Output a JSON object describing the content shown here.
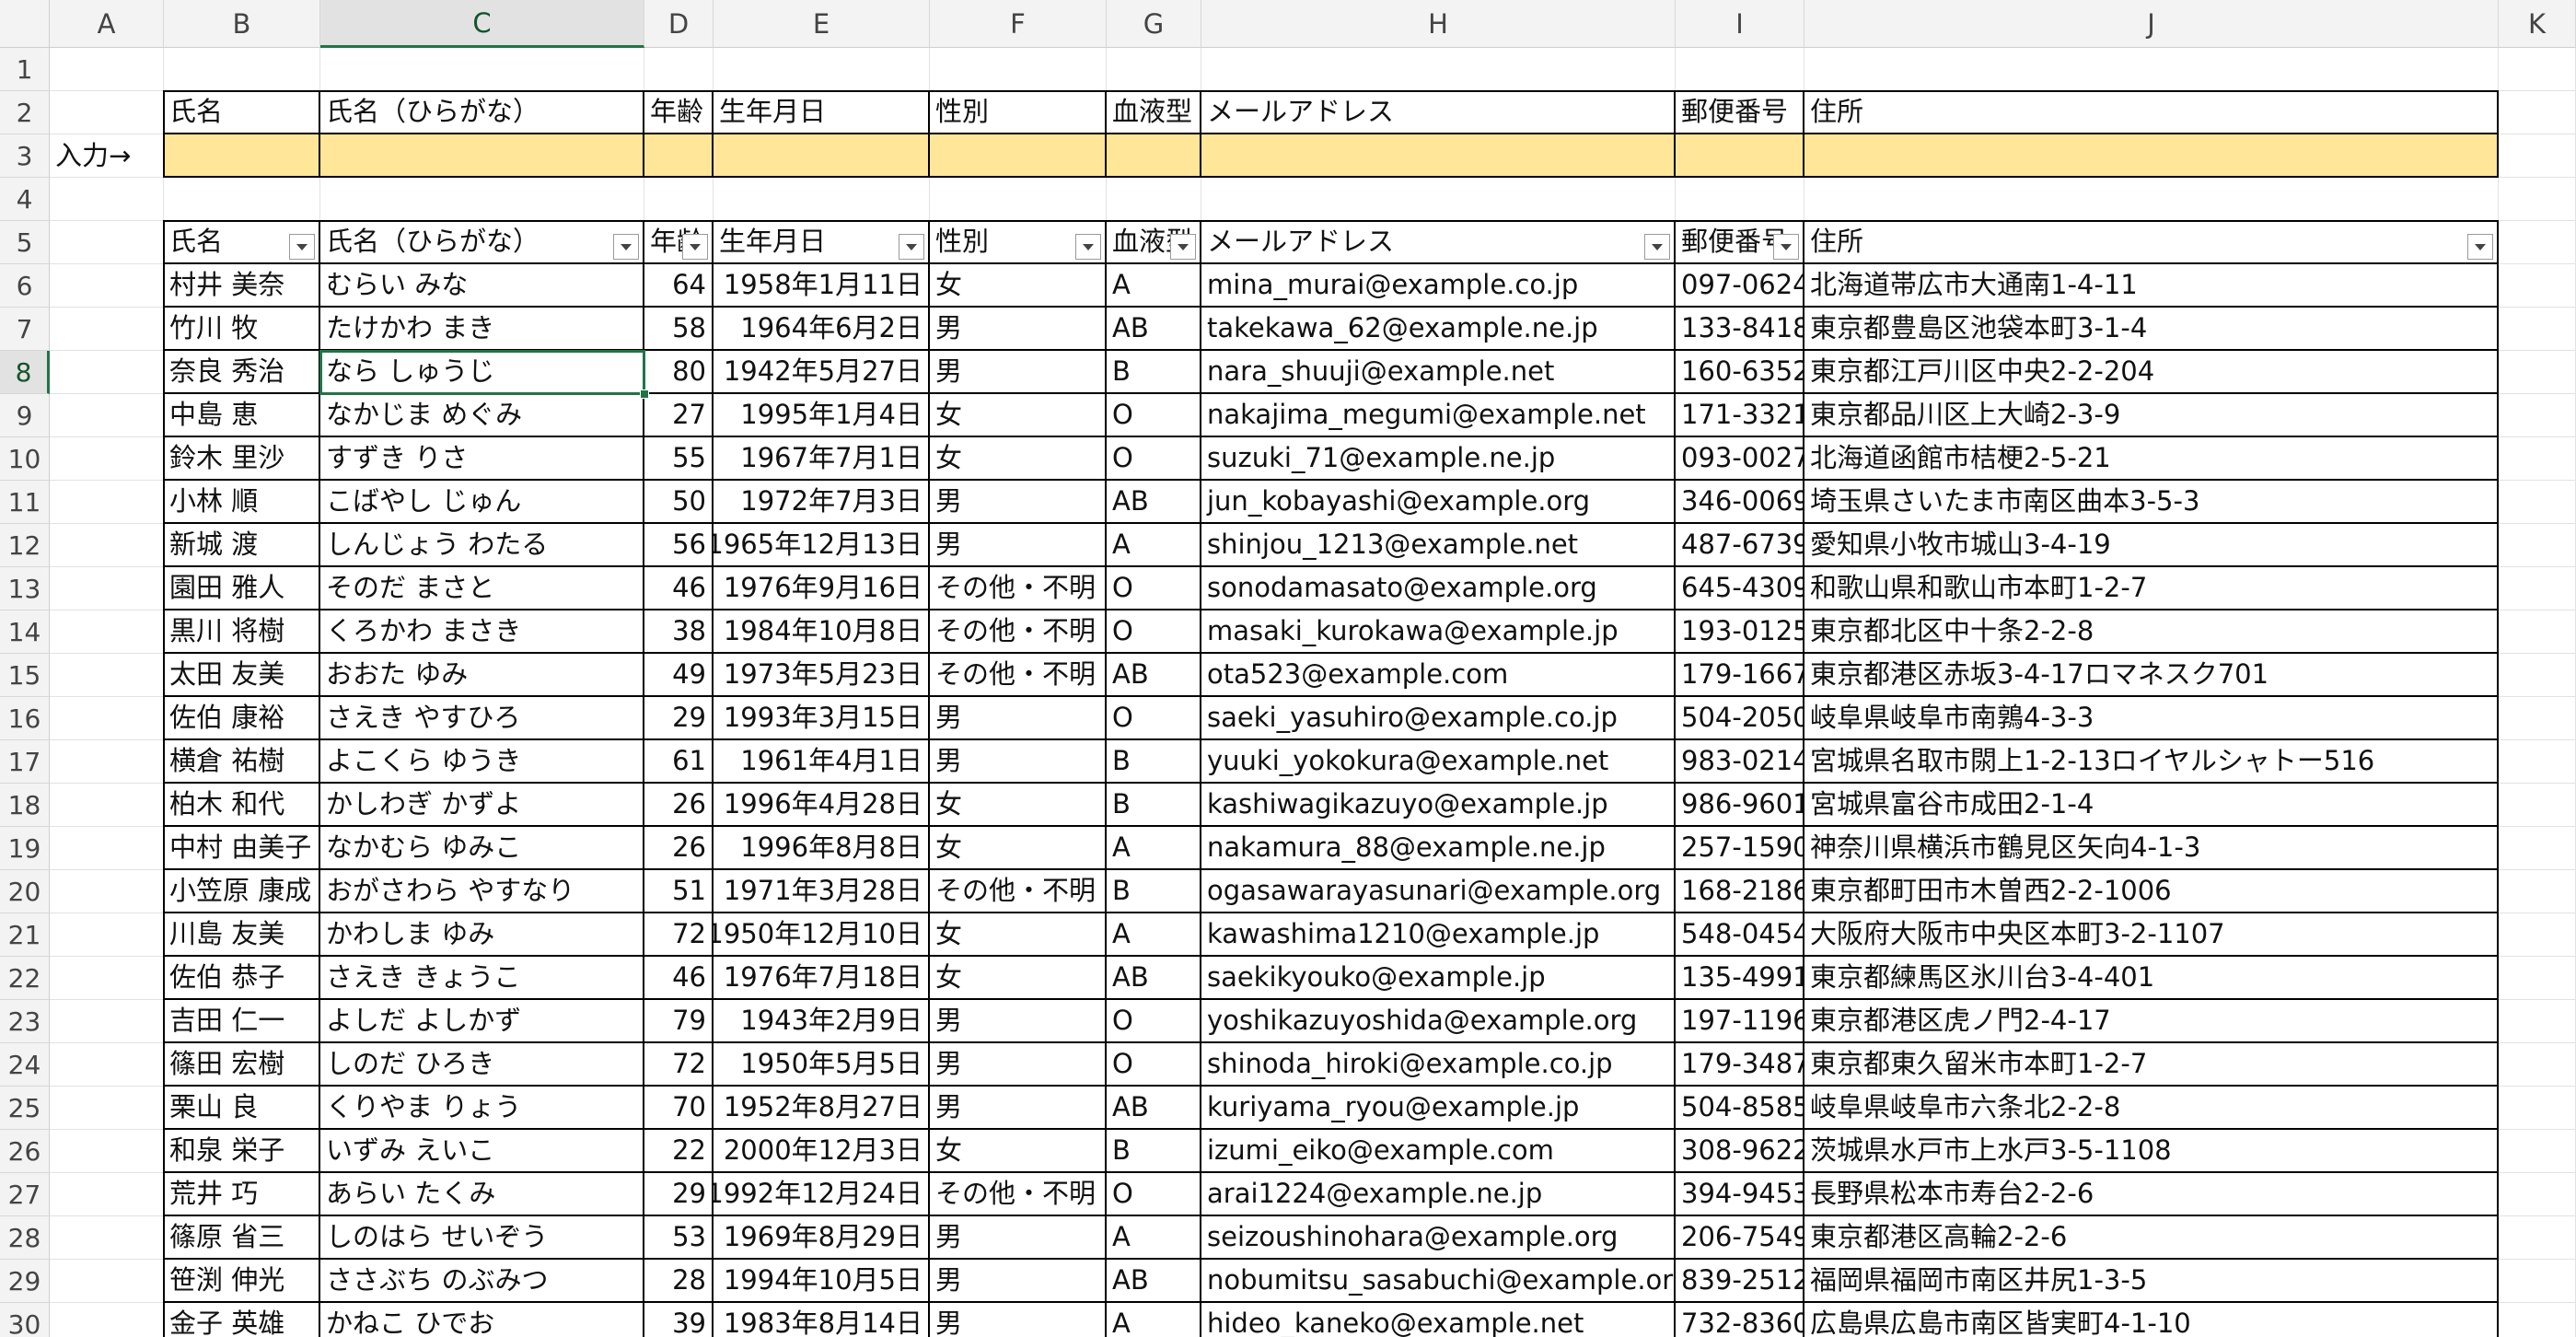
{
  "columns": [
    "A",
    "B",
    "C",
    "D",
    "E",
    "F",
    "G",
    "H",
    "I",
    "J",
    "K"
  ],
  "selected_column": "C",
  "selected_row": 8,
  "row_numbers": [
    1,
    2,
    3,
    4,
    5,
    6,
    7,
    8,
    9,
    10,
    11,
    12,
    13,
    14,
    15,
    16,
    17,
    18,
    19,
    20,
    21,
    22,
    23,
    24,
    25,
    26,
    27,
    28,
    29,
    30
  ],
  "input_label": "入力→",
  "input_headers": [
    "氏名",
    "氏名（ひらがな）",
    "年齢",
    "生年月日",
    "性別",
    "血液型",
    "メールアドレス",
    "郵便番号",
    "住所"
  ],
  "table_headers": [
    "氏名",
    "氏名（ひらがな）",
    "年齢",
    "生年月日",
    "性別",
    "血液型",
    "メールアドレス",
    "郵便番号",
    "住所"
  ],
  "colors": {
    "highlight": "#ffe699",
    "accent": "#217346"
  },
  "rows": [
    [
      "村井 美奈",
      "むらい みな",
      "64",
      "1958年1月11日",
      "女",
      "A",
      "mina_murai@example.co.jp",
      "097-0624",
      "北海道帯広市大通南1-4-11"
    ],
    [
      "竹川 牧",
      "たけかわ まき",
      "58",
      "1964年6月2日",
      "男",
      "AB",
      "takekawa_62@example.ne.jp",
      "133-8418",
      "東京都豊島区池袋本町3-1-4"
    ],
    [
      "奈良 秀治",
      "なら しゅうじ",
      "80",
      "1942年5月27日",
      "男",
      "B",
      "nara_shuuji@example.net",
      "160-6352",
      "東京都江戸川区中央2-2-204"
    ],
    [
      "中島 恵",
      "なかじま めぐみ",
      "27",
      "1995年1月4日",
      "女",
      "O",
      "nakajima_megumi@example.net",
      "171-3321",
      "東京都品川区上大崎2-3-9"
    ],
    [
      "鈴木 里沙",
      "すずき りさ",
      "55",
      "1967年7月1日",
      "女",
      "O",
      "suzuki_71@example.ne.jp",
      "093-0027",
      "北海道函館市桔梗2-5-21"
    ],
    [
      "小林 順",
      "こばやし じゅん",
      "50",
      "1972年7月3日",
      "男",
      "AB",
      "jun_kobayashi@example.org",
      "346-0069",
      "埼玉県さいたま市南区曲本3-5-3"
    ],
    [
      "新城 渡",
      "しんじょう わたる",
      "56",
      "1965年12月13日",
      "男",
      "A",
      "shinjou_1213@example.net",
      "487-6739",
      "愛知県小牧市城山3-4-19"
    ],
    [
      "園田 雅人",
      "そのだ まさと",
      "46",
      "1976年9月16日",
      "その他・不明",
      "O",
      "sonodamasato@example.org",
      "645-4309",
      "和歌山県和歌山市本町1-2-7"
    ],
    [
      "黒川 将樹",
      "くろかわ まさき",
      "38",
      "1984年10月8日",
      "その他・不明",
      "O",
      "masaki_kurokawa@example.jp",
      "193-0125",
      "東京都北区中十条2-2-8"
    ],
    [
      "太田 友美",
      "おおた ゆみ",
      "49",
      "1973年5月23日",
      "その他・不明",
      "AB",
      "ota523@example.com",
      "179-1667",
      "東京都港区赤坂3-4-17ロマネスク701"
    ],
    [
      "佐伯 康裕",
      "さえき やすひろ",
      "29",
      "1993年3月15日",
      "男",
      "O",
      "saeki_yasuhiro@example.co.jp",
      "504-2050",
      "岐阜県岐阜市南鶉4-3-3"
    ],
    [
      "横倉 祐樹",
      "よこくら ゆうき",
      "61",
      "1961年4月1日",
      "男",
      "B",
      "yuuki_yokokura@example.net",
      "983-0214",
      "宮城県名取市閖上1-2-13ロイヤルシャトー516"
    ],
    [
      "柏木 和代",
      "かしわぎ かずよ",
      "26",
      "1996年4月28日",
      "女",
      "B",
      "kashiwagikazuyo@example.jp",
      "986-9601",
      "宮城県富谷市成田2-1-4"
    ],
    [
      "中村 由美子",
      "なかむら ゆみこ",
      "26",
      "1996年8月8日",
      "女",
      "A",
      "nakamura_88@example.ne.jp",
      "257-1590",
      "神奈川県横浜市鶴見区矢向4-1-3"
    ],
    [
      "小笠原 康成",
      "おがさわら やすなり",
      "51",
      "1971年3月28日",
      "その他・不明",
      "B",
      "ogasawarayasunari@example.org",
      "168-2186",
      "東京都町田市木曽西2-2-1006"
    ],
    [
      "川島 友美",
      "かわしま ゆみ",
      "72",
      "1950年12月10日",
      "女",
      "A",
      "kawashima1210@example.jp",
      "548-0454",
      "大阪府大阪市中央区本町3-2-1107"
    ],
    [
      "佐伯 恭子",
      "さえき きょうこ",
      "46",
      "1976年7月18日",
      "女",
      "AB",
      "saekikyouko@example.jp",
      "135-4991",
      "東京都練馬区氷川台3-4-401"
    ],
    [
      "吉田 仁一",
      "よしだ よしかず",
      "79",
      "1943年2月9日",
      "男",
      "O",
      "yoshikazuyoshida@example.org",
      "197-1196",
      "東京都港区虎ノ門2-4-17"
    ],
    [
      "篠田 宏樹",
      "しのだ ひろき",
      "72",
      "1950年5月5日",
      "男",
      "O",
      "shinoda_hiroki@example.co.jp",
      "179-3487",
      "東京都東久留米市本町1-2-7"
    ],
    [
      "栗山 良",
      "くりやま りょう",
      "70",
      "1952年8月27日",
      "男",
      "AB",
      "kuriyama_ryou@example.jp",
      "504-8585",
      "岐阜県岐阜市六条北2-2-8"
    ],
    [
      "和泉 栄子",
      "いずみ えいこ",
      "22",
      "2000年12月3日",
      "女",
      "B",
      "izumi_eiko@example.com",
      "308-9622",
      "茨城県水戸市上水戸3-5-1108"
    ],
    [
      "荒井 巧",
      "あらい たくみ",
      "29",
      "1992年12月24日",
      "その他・不明",
      "O",
      "arai1224@example.ne.jp",
      "394-9453",
      "長野県松本市寿台2-2-6"
    ],
    [
      "篠原 省三",
      "しのはら せいぞう",
      "53",
      "1969年8月29日",
      "男",
      "A",
      "seizoushinohara@example.org",
      "206-7549",
      "東京都港区高輪2-2-6"
    ],
    [
      "笹渕 伸光",
      "ささぶち のぶみつ",
      "28",
      "1994年10月5日",
      "男",
      "AB",
      "nobumitsu_sasabuchi@example.org",
      "839-2512",
      "福岡県福岡市南区井尻1-3-5"
    ],
    [
      "金子 英雄",
      "かねこ ひでお",
      "39",
      "1983年8月14日",
      "男",
      "A",
      "hideo_kaneko@example.net",
      "732-8360",
      "広島県広島市南区皆実町4-1-10"
    ]
  ]
}
